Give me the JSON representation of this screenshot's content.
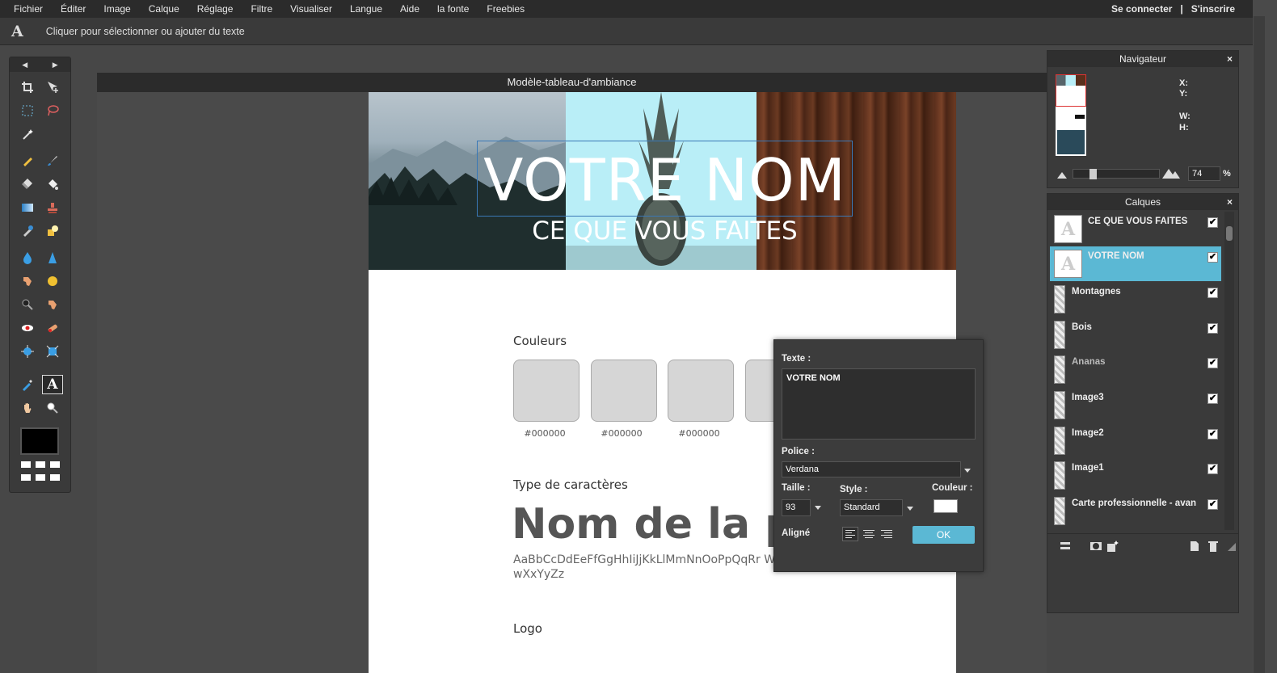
{
  "menu": {
    "items": [
      "Fichier",
      "Éditer",
      "Image",
      "Calque",
      "Réglage",
      "Filtre",
      "Visualiser",
      "Langue",
      "Aide",
      "la fonte",
      "Freebies"
    ],
    "login": "Se connecter",
    "separator": "|",
    "signup": "S'inscrire"
  },
  "options": {
    "tool_letter": "A",
    "hint": "Cliquer pour sélectionner ou ajouter du texte"
  },
  "toolbox": {
    "prev": "◀",
    "next": "▶",
    "foreground_color": "#000000"
  },
  "document": {
    "title": "Modèle-tableau-d'ambiance",
    "banner_title": "VOTRE NOM",
    "banner_subtitle": "CE QUE VOUS FAITES",
    "colors_label": "Couleurs",
    "swatches": [
      "#000000",
      "#000000",
      "#000000"
    ],
    "type_label": "Type de caractères",
    "font_name": "Nom de la p",
    "alphabet": "AaBbCcDdEeFfGgHhIiJjKkLlMmNnOoPpQqRr WwXxYyZz",
    "logo_label": "Logo"
  },
  "text_dialog": {
    "text_label": "Texte :",
    "text_value": "VOTRE NOM",
    "font_label": "Police :",
    "font_value": "Verdana",
    "size_label": "Taille :",
    "size_value": "93",
    "style_label": "Style :",
    "style_value": "Standard",
    "color_label": "Couleur :",
    "color_value": "#ffffff",
    "align_label": "Aligné",
    "ok": "OK"
  },
  "navigator": {
    "title": "Navigateur",
    "close": "×",
    "x_label": "X:",
    "y_label": "Y:",
    "w_label": "W:",
    "h_label": "H:",
    "zoom": "74",
    "zoom_unit": "%"
  },
  "layers": {
    "title": "Calques",
    "close": "×",
    "items": [
      {
        "name": "CE QUE VOUS FAITES",
        "type": "text",
        "selected": false
      },
      {
        "name": "VOTRE NOM",
        "type": "text",
        "selected": true
      },
      {
        "name": "Montagnes",
        "type": "image",
        "selected": false
      },
      {
        "name": "Bois",
        "type": "image",
        "selected": false
      },
      {
        "name": "Ananas",
        "type": "image",
        "selected": false
      },
      {
        "name": "Image3",
        "type": "image",
        "selected": false
      },
      {
        "name": "Image2",
        "type": "image",
        "selected": false
      },
      {
        "name": "Image1",
        "type": "image",
        "selected": false
      },
      {
        "name": "Carte professionnelle - avan",
        "type": "image",
        "selected": false
      }
    ],
    "check_glyph": "✔"
  },
  "colors": {
    "accent": "#5bb8d4",
    "selection_border": "#3a78b6"
  }
}
